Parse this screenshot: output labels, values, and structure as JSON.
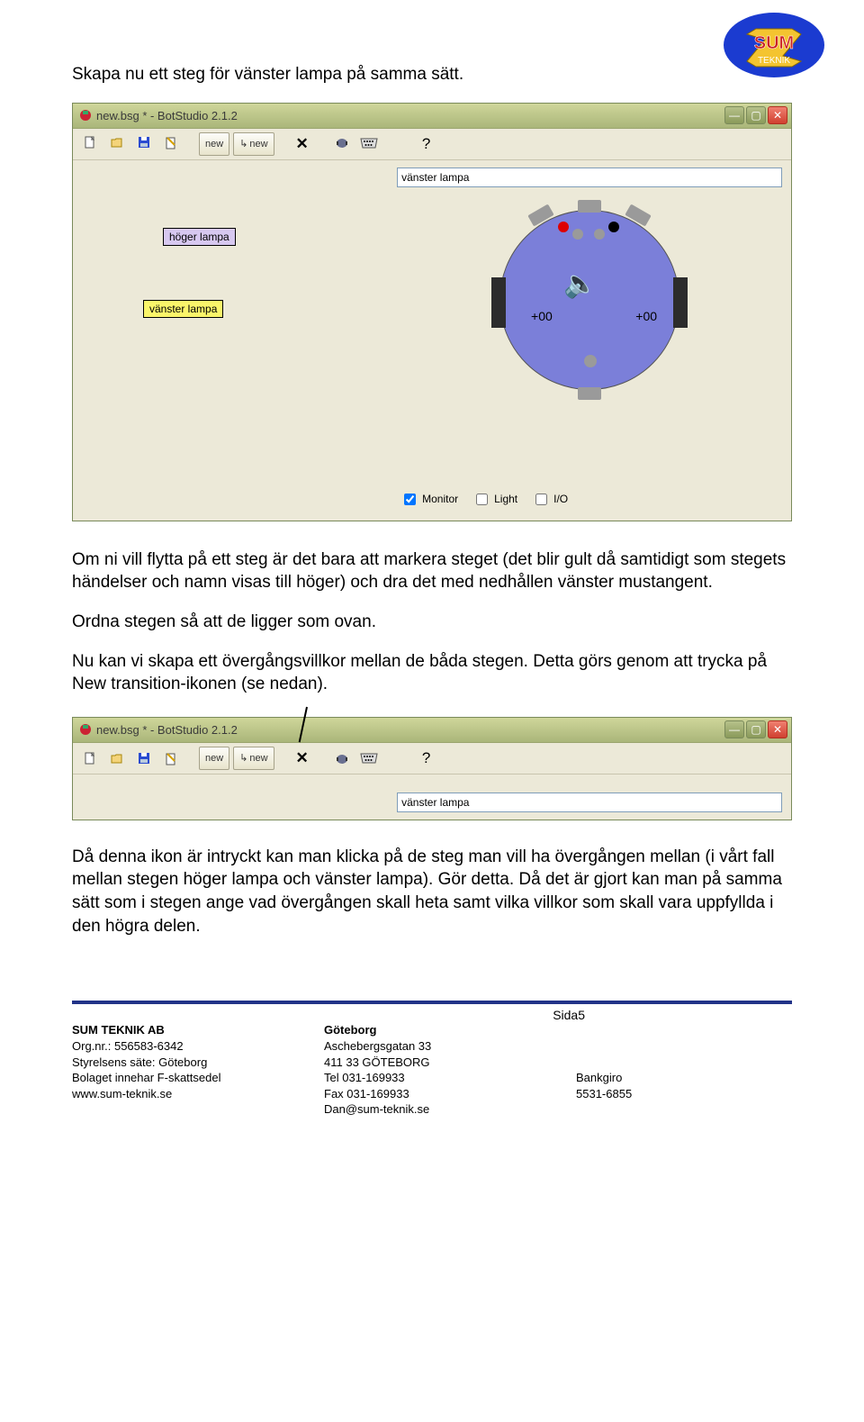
{
  "logo": {
    "top_text": "SUM",
    "bottom_text": "TEKNIK"
  },
  "paragraphs": {
    "intro": "Skapa nu ett steg för vänster lampa på samma sätt.",
    "after1": "Om ni vill flytta på ett steg är det bara att markera steget (det blir gult då samtidigt som stegets händelser och namn visas till höger) och dra det med nedhållen vänster mustangent.",
    "after2": "Ordna stegen så att de ligger som ovan.",
    "after3": "Nu kan vi skapa ett övergångsvillkor mellan de båda stegen. Detta görs genom att trycka på New transition-ikonen (se nedan).",
    "after4": "Då denna ikon är intryckt kan man klicka på de steg man vill ha övergången mellan (i vårt fall mellan stegen höger lampa och vänster lampa). Gör detta. Då det är gjort kan man på samma sätt som i stegen ange vad övergången skall heta samt vilka villkor som skall vara uppfyllda i den högra delen."
  },
  "app": {
    "title": "new.bsg * - BotStudio 2.1.2",
    "toolbar": {
      "new_step": "new",
      "new_transition": "new",
      "help": "?"
    },
    "name_field": "vänster lampa",
    "steps": {
      "hoger": "höger lampa",
      "vanster": "vänster lampa"
    },
    "robot": {
      "left_val": "+00",
      "right_val": "+00"
    },
    "checks": {
      "monitor": "Monitor",
      "light": "Light",
      "io": "I/O"
    }
  },
  "footer": {
    "page": "Sida5",
    "company": "SUM TEKNIK AB",
    "org": "Org.nr.: 556583-6342",
    "seat": "Styrelsens säte: Göteborg",
    "fskatt": "Bolaget innehar F-skattsedel",
    "www": "www.sum-teknik.se",
    "city": "Göteborg",
    "street": "Aschebergsgatan 33",
    "zip": "411 33 GÖTEBORG",
    "tel": "Tel 031-169933",
    "fax": "Fax 031-169933",
    "email": "Dan@sum-teknik.se",
    "bg_label": "Bankgiro",
    "bg": "5531-6855"
  }
}
